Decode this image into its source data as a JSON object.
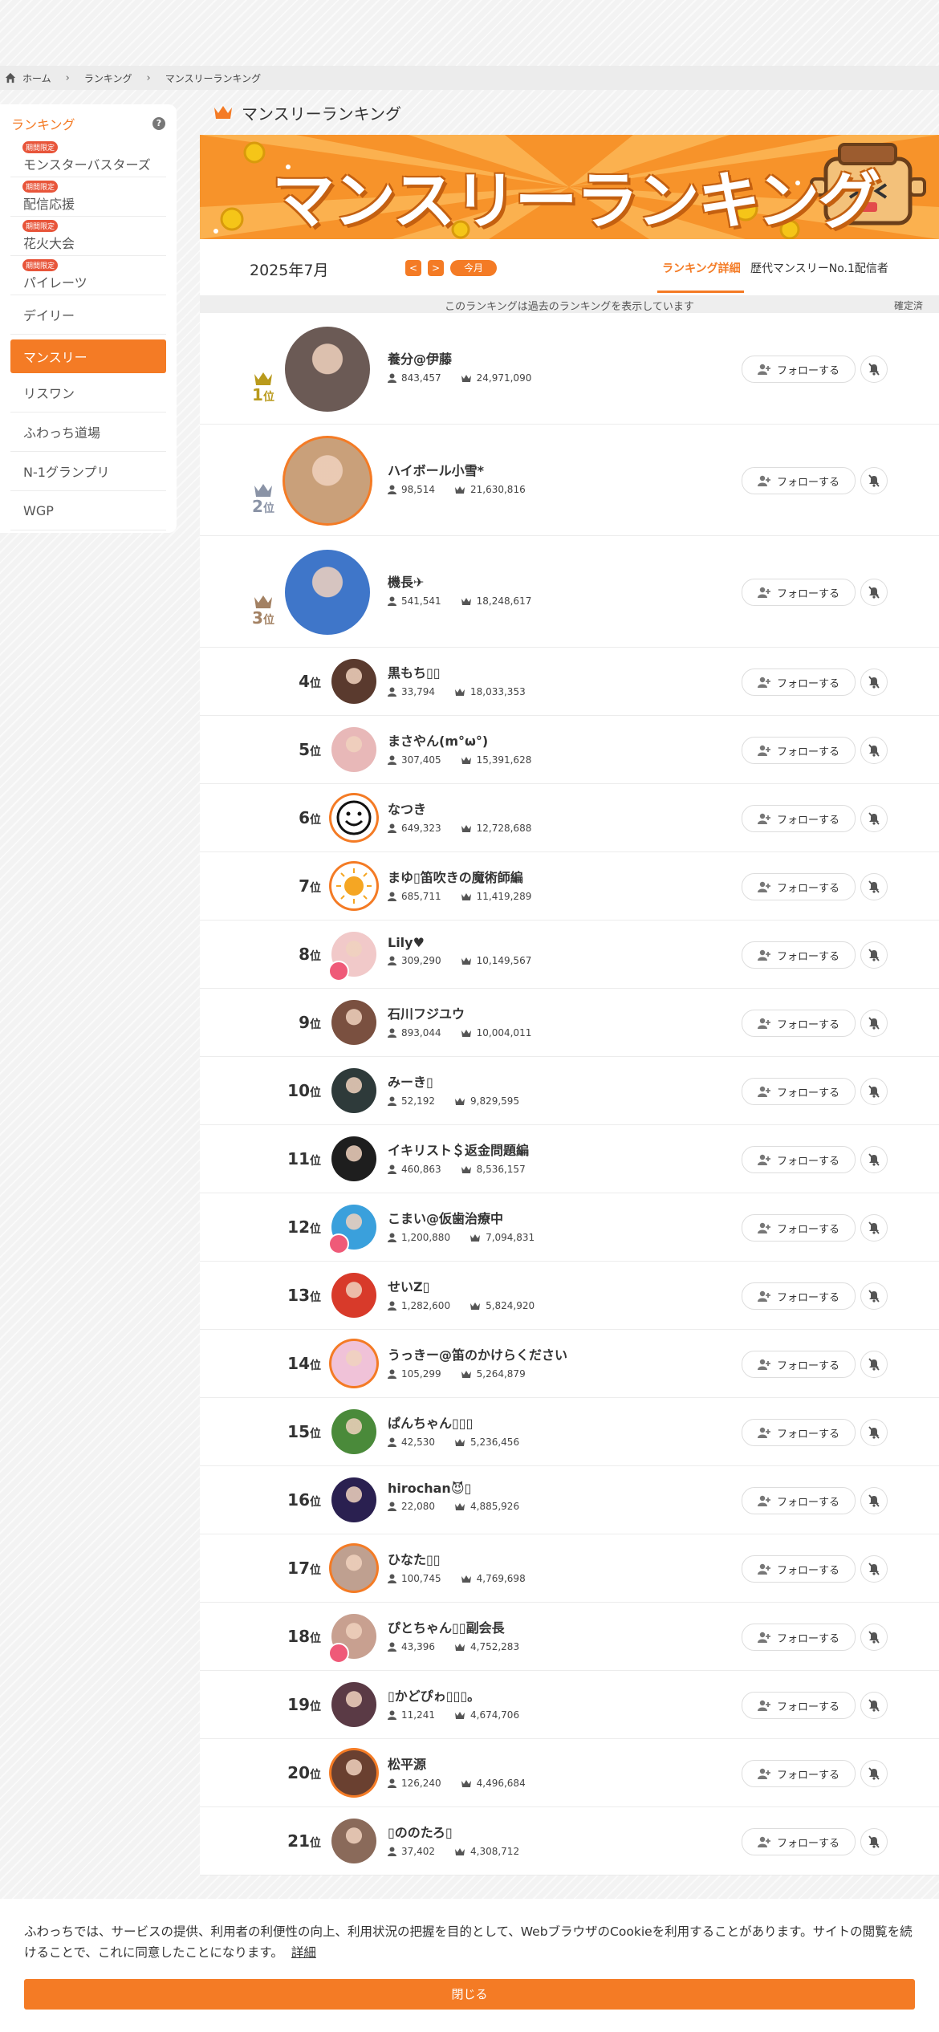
{
  "breadcrumb": {
    "home": "ホーム",
    "ranking": "ランキング",
    "current": "マンスリーランキング"
  },
  "sidebar": {
    "title": "ランキング",
    "items": [
      {
        "label": "モンスターバスターズ",
        "badge": "期間限定"
      },
      {
        "label": "配信応援",
        "badge": "期間限定"
      },
      {
        "label": "花火大会",
        "badge": "期間限定"
      },
      {
        "label": "パイレーツ",
        "badge": "期間限定"
      },
      {
        "label": "デイリー"
      },
      {
        "label": "マンスリー",
        "active": true
      },
      {
        "label": "リスワン"
      },
      {
        "label": "ふわっち道場"
      },
      {
        "label": "N-1グランプリ"
      },
      {
        "label": "WGP"
      }
    ]
  },
  "page": {
    "title": "マンスリーランキング",
    "banner": "マンスリーランキング"
  },
  "datebar": {
    "month": "2025年7月",
    "prev": "<",
    "next": ">",
    "this_month": "今月",
    "tab_detail": "ランキング詳細",
    "tab_history": "歴代マンスリーNo.1配信者"
  },
  "note": {
    "text": "このランキングは過去のランキングを表示しています",
    "status": "確定済"
  },
  "buttons": {
    "follow": "フォローする"
  },
  "rank_suffix": "位",
  "rankings": [
    {
      "rank": "1",
      "name": "養分@伊藤",
      "followers": "843,457",
      "points": "24,971,090"
    },
    {
      "rank": "2",
      "name": "ハイボール小雪*",
      "followers": "98,514",
      "points": "21,630,816"
    },
    {
      "rank": "3",
      "name": "機長✈",
      "followers": "541,541",
      "points": "18,248,617"
    },
    {
      "rank": "4",
      "name": "黒もち▯▯",
      "followers": "33,794",
      "points": "18,033,353"
    },
    {
      "rank": "5",
      "name": "まさやん(m°ω°)",
      "followers": "307,405",
      "points": "15,391,628"
    },
    {
      "rank": "6",
      "name": "なつき",
      "followers": "649,323",
      "points": "12,728,688"
    },
    {
      "rank": "7",
      "name": "まゆ▯笛吹きの魔術師編",
      "followers": "685,711",
      "points": "11,419,289"
    },
    {
      "rank": "8",
      "name": "Lily♥",
      "followers": "309,290",
      "points": "10,149,567"
    },
    {
      "rank": "9",
      "name": "石川フジユウ",
      "followers": "893,044",
      "points": "10,004,011"
    },
    {
      "rank": "10",
      "name": "みーき▯",
      "followers": "52,192",
      "points": "9,829,595"
    },
    {
      "rank": "11",
      "name": "イキリスト＄返金問題編",
      "followers": "460,863",
      "points": "8,536,157"
    },
    {
      "rank": "12",
      "name": "こまい@仮歯治療中",
      "followers": "1,200,880",
      "points": "7,094,831"
    },
    {
      "rank": "13",
      "name": "せいZ▯",
      "followers": "1,282,600",
      "points": "5,824,920"
    },
    {
      "rank": "14",
      "name": "うっきー@笛のかけらください",
      "followers": "105,299",
      "points": "5,264,879"
    },
    {
      "rank": "15",
      "name": "ぱんちゃん▯▯▯",
      "followers": "42,530",
      "points": "5,236,456"
    },
    {
      "rank": "16",
      "name": "hirochan😈▯",
      "followers": "22,080",
      "points": "4,885,926"
    },
    {
      "rank": "17",
      "name": "ひなた▯▯",
      "followers": "100,745",
      "points": "4,769,698"
    },
    {
      "rank": "18",
      "name": "ぴとちゃん▯▯副会長",
      "followers": "43,396",
      "points": "4,752,283"
    },
    {
      "rank": "19",
      "name": "▯かどぴゎ▯▯▯｡",
      "followers": "11,241",
      "points": "4,674,706"
    },
    {
      "rank": "20",
      "name": "松平源",
      "followers": "126,240",
      "points": "4,496,684"
    },
    {
      "rank": "21",
      "name": "▯ののたろ▯",
      "followers": "37,402",
      "points": "4,308,712"
    }
  ],
  "cookie": {
    "text": "ふわっちでは、サービスの提供、利用者の利便性の向上、利用状況の把握を目的として、WebブラウザのCookieを利用することがあります。サイトの閲覧を続けることで、これに同意したことになります。",
    "link": "詳細",
    "close": "閉じる"
  },
  "colors": {
    "accent": "#f47b25",
    "gold": "#b99a1c",
    "silver": "#8a93a6",
    "bronze": "#a38163"
  }
}
